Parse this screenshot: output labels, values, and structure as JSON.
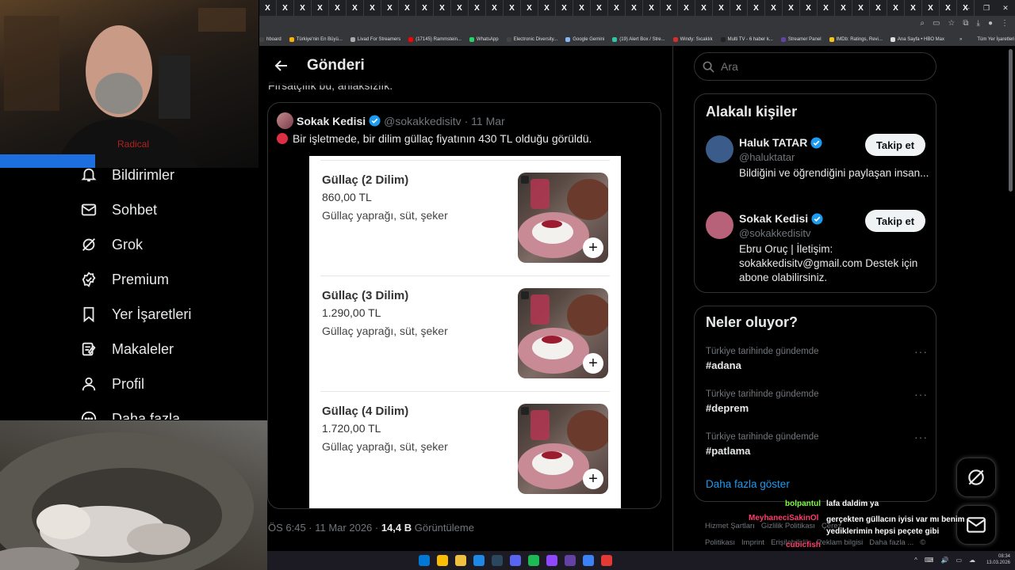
{
  "tabs": [
    "X",
    "X",
    "X",
    "X",
    "X",
    "X",
    "X",
    "X",
    "X",
    "X",
    "X",
    "X",
    "X",
    "X",
    "X",
    "X",
    "X",
    "X",
    "X",
    "X",
    "X",
    "X",
    "X",
    "X",
    "X",
    "X",
    "X",
    "X",
    "X",
    "X",
    "X",
    "X",
    "X",
    "X",
    "X",
    "X",
    "X",
    "X",
    "X",
    "X",
    "X"
  ],
  "window_controls": {
    "min": "–",
    "max": "❐",
    "close": "✕"
  },
  "bookmarks": [
    {
      "label": "hboard",
      "color": "#444"
    },
    {
      "label": "Türkiye'nin En Büyü...",
      "color": "#f4b400"
    },
    {
      "label": "Livad For Streamers",
      "color": "#aaa"
    },
    {
      "label": "(17145) Rammstein...",
      "color": "#ff0000"
    },
    {
      "label": "WhatsApp",
      "color": "#25d366"
    },
    {
      "label": "Electronic Diversity...",
      "color": "#444"
    },
    {
      "label": "Google Gemini",
      "color": "#8ab4f8"
    },
    {
      "label": "(19) Alert Box / Stre...",
      "color": "#31c3a2"
    },
    {
      "label": "Windy: Sıcaklık",
      "color": "#d62d2d"
    },
    {
      "label": "Multi TV - 6 haber k...",
      "color": "#222"
    },
    {
      "label": "Streamer Panel",
      "color": "#6441a5"
    },
    {
      "label": "IMDb: Ratings, Revi...",
      "color": "#f5c518"
    },
    {
      "label": "Ana Sayfa • HBO Max",
      "color": "#ddd"
    },
    {
      "label": "»",
      "color": "#35363a"
    },
    {
      "label": "Tüm Yer İşaretleri",
      "color": "#35363a"
    }
  ],
  "nav": {
    "items": [
      {
        "label": "Bildirimler",
        "icon": "bell-icon"
      },
      {
        "label": "Sohbet",
        "icon": "mail-icon"
      },
      {
        "label": "Grok",
        "icon": "grok-icon"
      },
      {
        "label": "Premium",
        "icon": "premium-icon"
      },
      {
        "label": "Yer İşaretleri",
        "icon": "bookmark-icon"
      },
      {
        "label": "Makaleler",
        "icon": "article-icon"
      },
      {
        "label": "Profil",
        "icon": "profile-icon"
      },
      {
        "label": "Daha fazla",
        "icon": "more-icon"
      }
    ]
  },
  "header": {
    "title": "Gönderi"
  },
  "post": {
    "prev_text": "Fırsatçılık bu, anlaksızlık.",
    "quote": {
      "name": "Sokak Kedisi",
      "handle": "@sokakkedisitv",
      "date": "· 11 Mar",
      "text": "Bir işletmede, bir dilim güllaç fiyatının 430 TL olduğu görüldü."
    },
    "menu": [
      {
        "name": "Güllaç (2 Dilim)",
        "price": "860,00 TL",
        "desc": "Güllaç yaprağı, süt, şeker"
      },
      {
        "name": "Güllaç (3 Dilim)",
        "price": "1.290,00 TL",
        "desc": "Güllaç yaprağı, süt, şeker"
      },
      {
        "name": "Güllaç (4 Dilim)",
        "price": "1.720,00 TL",
        "desc": "Güllaç yaprağı, süt, şeker"
      }
    ],
    "meta": {
      "time": "ÖS 6:45 · 11 Mar 2026 · ",
      "views": "14,4 B",
      "views_label": " Görüntüleme"
    }
  },
  "search": {
    "placeholder": "Ara"
  },
  "related": {
    "title": "Alakalı kişiler",
    "people": [
      {
        "name": "Haluk TATAR",
        "handle": "@haluktatar",
        "bio": "Bildiğini ve öğrendiğini paylaşan insan...",
        "button": "Takip et",
        "avatar_color": "#3b5c8a"
      },
      {
        "name": "Sokak Kedisi",
        "handle": "@sokakkedisitv",
        "bio": "Ebru Oruç | İletişim: sokakkedisitv@gmail.com Destek için abone olabilirsiniz.",
        "button": "Takip et",
        "avatar_color": "#b8627a"
      }
    ]
  },
  "trends": {
    "title": "Neler oluyor?",
    "items": [
      {
        "context": "Türkiye tarihinde gündemde",
        "tag": "#adana"
      },
      {
        "context": "Türkiye tarihinde gündemde",
        "tag": "#deprem"
      },
      {
        "context": "Türkiye tarihinde gündemde",
        "tag": "#patlama"
      }
    ],
    "more_icon": "···",
    "show_more": "Daha fazla göster"
  },
  "footer": [
    "Hizmet Şartları",
    "Gizlilik Politikası",
    "Çerez Politikası",
    "Imprint",
    "Erişilebilirlik",
    "Reklam bilgisi",
    "Daha fazla ...",
    "© 2026 X Corp."
  ],
  "chat": [
    {
      "user": "bolpantul",
      "user_color": "#7fff3f",
      "msg": "lafa daldim ya"
    },
    {
      "user": "MeyhaneciSakinOl",
      "user_color": "#ff3d6e",
      "msg": "gerçekten güllacın iyisi var mı benim yediklerimin hepsi peçete gibi"
    },
    {
      "user": "cubicfish",
      "user_color": "#ff3d6e",
      "msg": ""
    }
  ],
  "taskbar": {
    "time": "08:34",
    "date": "13.03.2026",
    "apps": [
      "#0078d4",
      "#fbbc04",
      "#f0c040",
      "#1e88e5",
      "#2a475e",
      "#5865f2",
      "#1db954",
      "#9146ff",
      "#6441a5",
      "#3b82f6",
      "#e53935"
    ]
  },
  "tray_icons": [
    "^",
    "⌨",
    "🔊",
    "▭",
    "☁"
  ]
}
